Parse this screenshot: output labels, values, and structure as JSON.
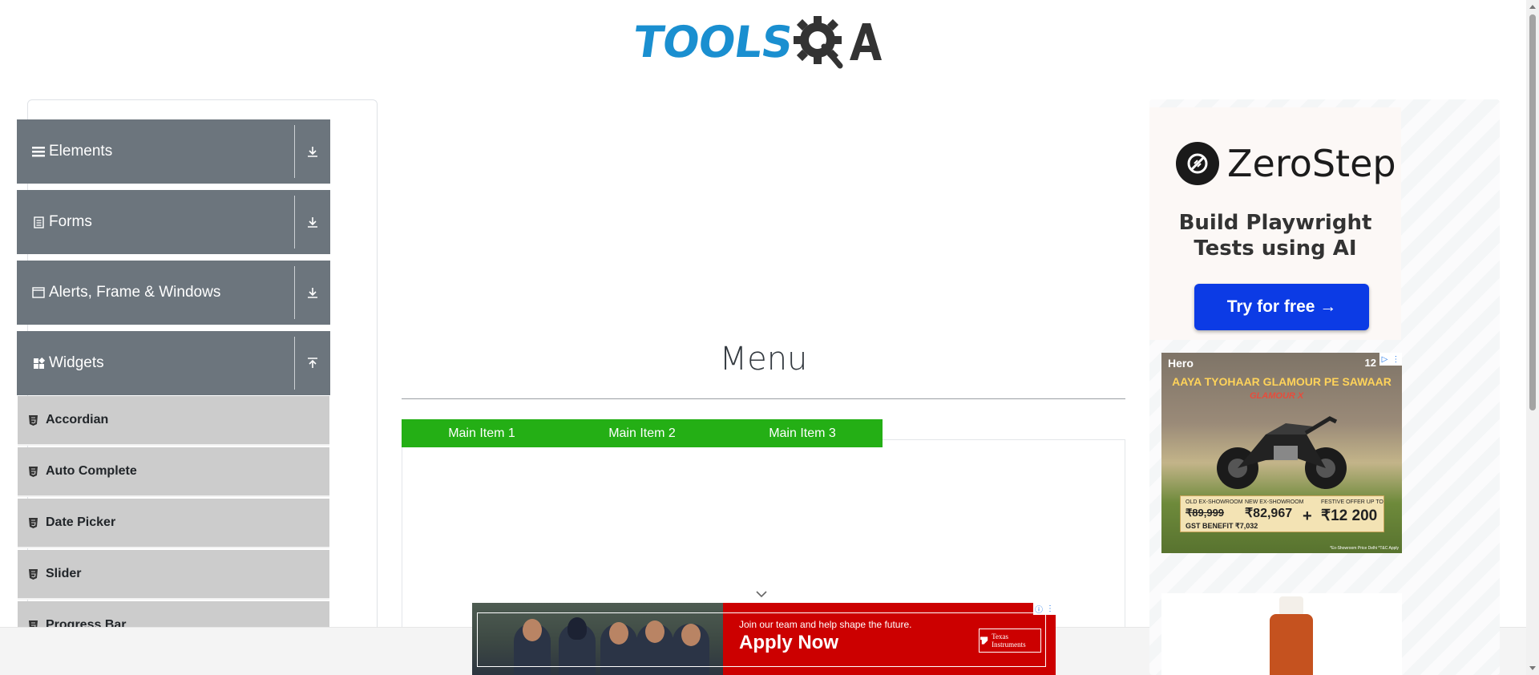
{
  "header": {
    "logo_text_left": "TOOLS",
    "logo_text_right": "QA"
  },
  "sidebar": {
    "groups": [
      {
        "label": "Elements",
        "icon": "hamburger-icon",
        "arrow": "download-icon"
      },
      {
        "label": "Forms",
        "icon": "document-icon",
        "arrow": "download-icon"
      },
      {
        "label": "Alerts, Frame & Windows",
        "icon": "window-icon",
        "arrow": "download-icon"
      },
      {
        "label": "Widgets",
        "icon": "widgets-icon",
        "arrow": "upload-icon"
      }
    ],
    "widget_items": [
      "Accordian",
      "Auto Complete",
      "Date Picker",
      "Slider",
      "Progress Bar"
    ]
  },
  "main": {
    "title": "Menu",
    "menu_items": [
      "Main Item 1",
      "Main Item 2",
      "Main Item 3"
    ]
  },
  "ads": {
    "zerostep": {
      "brand": "ZeroStep",
      "tagline_line1": "Build Playwright",
      "tagline_line2": "Tests using AI",
      "cta": "Try for free →"
    },
    "hero": {
      "brand": "Hero",
      "year": "12",
      "slogan": "AAYA TYOHAAR GLAMOUR PE SAWAAR",
      "model": "GLAMOUR X",
      "old_label": "OLD EX-SHOWROOM",
      "old_price": "₹89,999",
      "new_label": "NEW EX-SHOWROOM",
      "new_price": "₹82,967",
      "festive_label": "FESTIVE OFFER UP TO",
      "festive_price": "₹12 200",
      "gst": "GST BENEFIT  ₹7,032",
      "fine_print": "*Ex-Showroom Price Delhi *T&C Apply"
    },
    "texas": {
      "subtitle": "Join our team and help shape the future.",
      "headline": "Apply Now",
      "brand": "Texas Instruments"
    }
  }
}
